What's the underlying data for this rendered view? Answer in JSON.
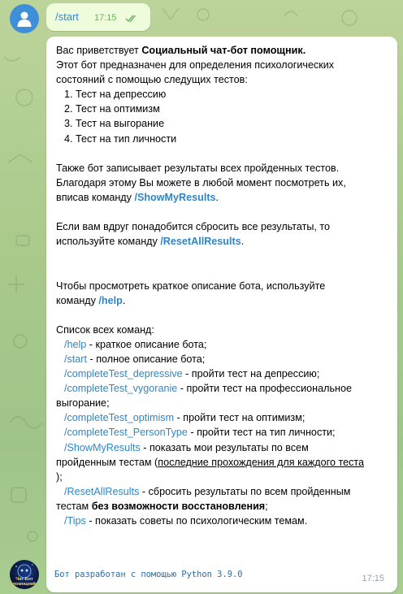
{
  "outgoing": {
    "text": "/start",
    "time": "17:15",
    "status_icon": "double-check-icon"
  },
  "incoming": {
    "greeting_prefix": "Вас приветствует ",
    "bot_name": "Социальный чат-бот помощник.",
    "intro_line1": "Этот бот предназначен для определения психологических",
    "intro_line2": "состояний с помощью следущих тестов:",
    "tests": [
      "1. Тест на депрессию",
      "2. Тест на оптимизм",
      "3. Тест на выгорание",
      "4. Тест на тип личности"
    ],
    "save_line1": "Также бот записывает результаты всех пройденных тестов.",
    "save_line2": "Благодаря этому Вы можете в любой момент посмотреть их,",
    "save_line3_prefix": "вписав команду ",
    "save_cmd": "/ShowMyResults",
    "save_suffix": ".",
    "reset_line1": "Если вам вдруг понадобится сбросить все результаты, то",
    "reset_line2_prefix": "используйте команду ",
    "reset_cmd": "/ResetAllResults",
    "reset_suffix": ".",
    "help_line1": "Чтобы просмотреть краткое описание бота, используйте",
    "help_line2_prefix": "команду ",
    "help_cmd": "/help",
    "help_suffix": ".",
    "commands_title": "Список всех команд:",
    "commands": {
      "help_cmd": "/help",
      "help_desc": " - краткое описание бота;",
      "start_cmd": "/start",
      "start_desc": " - полное описание бота;",
      "depr_cmd": "/completeTest_depressive",
      "depr_desc": " - пройти тест на депрессию;",
      "vyg_cmd": "/completeTest_vygoranie",
      "vyg_desc1": " - пройти тест на профессиональное",
      "vyg_desc2": "выгорание;",
      "opt_cmd": "/completeTest_optimism",
      "opt_desc": " - пройти тест на оптимизм;",
      "pers_cmd": "/completeTest_PersonType",
      "pers_desc": " - пройти тест на тип личности;",
      "show_cmd": "/ShowMyResults",
      "show_desc1": " - показать мои результаты по всем",
      "show_desc2_prefix": "пройденным тестам (",
      "show_desc2_ul": "последние прохождения для каждого теста",
      "show_desc3": ");",
      "reset_cmd": "/ResetAllResults",
      "reset_desc1": " - сбросить результаты по всем пройденным",
      "reset_desc2_prefix": "тестам ",
      "reset_desc2_bold": "без возможности восстановления",
      "reset_desc2_suffix": ";",
      "tips_cmd": "/Tips",
      "tips_desc": " - показать советы по психологическим темам."
    },
    "footer": "Бот разработан с помощью Python 3.9.0",
    "time": "17:15"
  },
  "avatars": {
    "user_icon": "user-icon",
    "bot_logo_text": "Чат-Бот помощник"
  },
  "colors": {
    "link": "#2f86c6",
    "outgoing_bubble": "#eefcdc",
    "incoming_bubble": "#ffffff",
    "background": "#a8c98a"
  }
}
